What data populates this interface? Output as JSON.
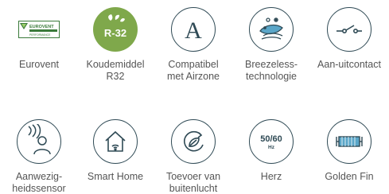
{
  "features": [
    {
      "label": "Eurovent",
      "icon": "eurovent-logo-icon",
      "badge_text": "EUROVENT CERTIFIED PERFORMANCE"
    },
    {
      "label": "Koudemiddel\nR32",
      "icon": "r32-refrigerant-icon",
      "badge_text": "R-32"
    },
    {
      "label": "Compatibel\nmet Airzone",
      "icon": "airzone-icon",
      "badge_text": "A"
    },
    {
      "label": "Breezeless-\ntechnologie",
      "icon": "breezeless-icon"
    },
    {
      "label": "Aan-uitcontact",
      "icon": "on-off-switch-icon"
    },
    {
      "label": "Aanwezig-\nheidssensor",
      "icon": "presence-sensor-icon"
    },
    {
      "label": "Smart Home",
      "icon": "smart-home-icon"
    },
    {
      "label": "Toevoer van\nbuitenlucht",
      "icon": "fresh-air-intake-icon"
    },
    {
      "label": "Herz",
      "icon": "hertz-icon",
      "badge_text": "50/60",
      "badge_sub": "Hz"
    },
    {
      "label": "Golden Fin",
      "icon": "golden-fin-icon"
    }
  ],
  "colors": {
    "icon_stroke": "#2f4a55",
    "label": "#555555",
    "r32_green": "#7fa84b",
    "eurovent_green": "#3a7a3a"
  }
}
